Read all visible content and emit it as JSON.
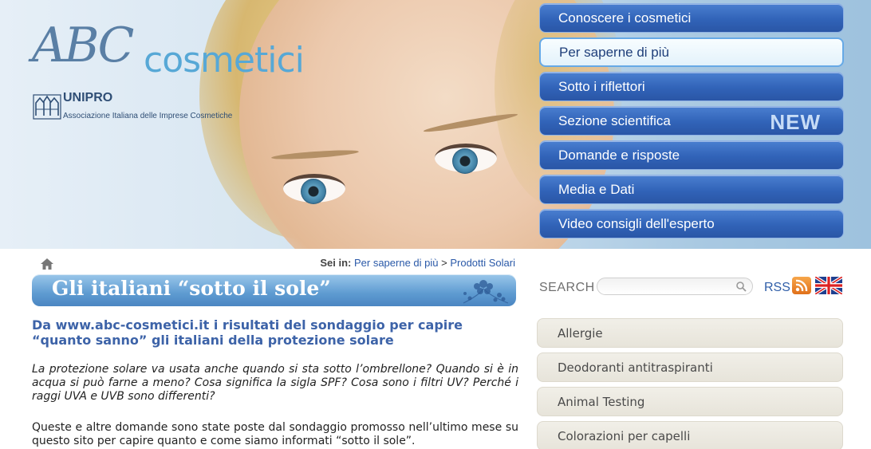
{
  "header": {
    "logo_abc": "ABC",
    "logo_cosmetici": "cosmetici",
    "unipro_name": "UNIPRO",
    "unipro_tagline": "Associazione Italiana delle Imprese Cosmetiche"
  },
  "topnav": {
    "items": [
      {
        "label": "Conoscere i cosmetici",
        "active": false
      },
      {
        "label": "Per saperne di più",
        "active": true
      },
      {
        "label": "Sotto i riflettori",
        "active": false
      },
      {
        "label": "Sezione scientifica",
        "active": false,
        "badge": "NEW"
      },
      {
        "label": "Domande e risposte",
        "active": false
      },
      {
        "label": "Media e Dati",
        "active": false
      },
      {
        "label": "Video consigli dell'esperto",
        "active": false
      }
    ]
  },
  "breadcrumb": {
    "prefix": "Sei in:",
    "items": [
      "Per saperne di più",
      "Prodotti Solari"
    ],
    "separator": ">"
  },
  "page": {
    "title": "Gli italiani “sotto il sole”"
  },
  "article": {
    "heading": "Da www.abc-cosmetici.it i risultati del sondaggio per capire “quanto sanno” gli italiani della protezione solare",
    "intro": "La protezione solare va usata anche quando si sta sotto l’ombrellone? Quando si è in acqua si può farne a meno? Cosa significa la sigla SPF? Cosa sono i filtri UV? Perché i raggi UVA e UVB sono differenti?",
    "body": "Queste e altre domande sono state poste dal sondaggio promosso nell’ultimo mese su questo sito per capire quanto e come siamo informati “sotto il sole”."
  },
  "search": {
    "label": "SEARCH",
    "value": "",
    "placeholder": ""
  },
  "rss": {
    "label": "RSS"
  },
  "side_menu": {
    "items": [
      "Allergie",
      "Deodoranti antitraspiranti",
      "Animal Testing",
      "Colorazioni per capelli"
    ]
  },
  "colors": {
    "nav_blue": "#3163b8",
    "title_bar_blue": "#5e9bd1",
    "heading_blue": "#3d63a8",
    "side_menu_bg": "#e7e4da"
  },
  "icons": [
    "home-icon",
    "search-icon",
    "rss-icon",
    "uk-flag-icon",
    "unipro-emblem"
  ]
}
